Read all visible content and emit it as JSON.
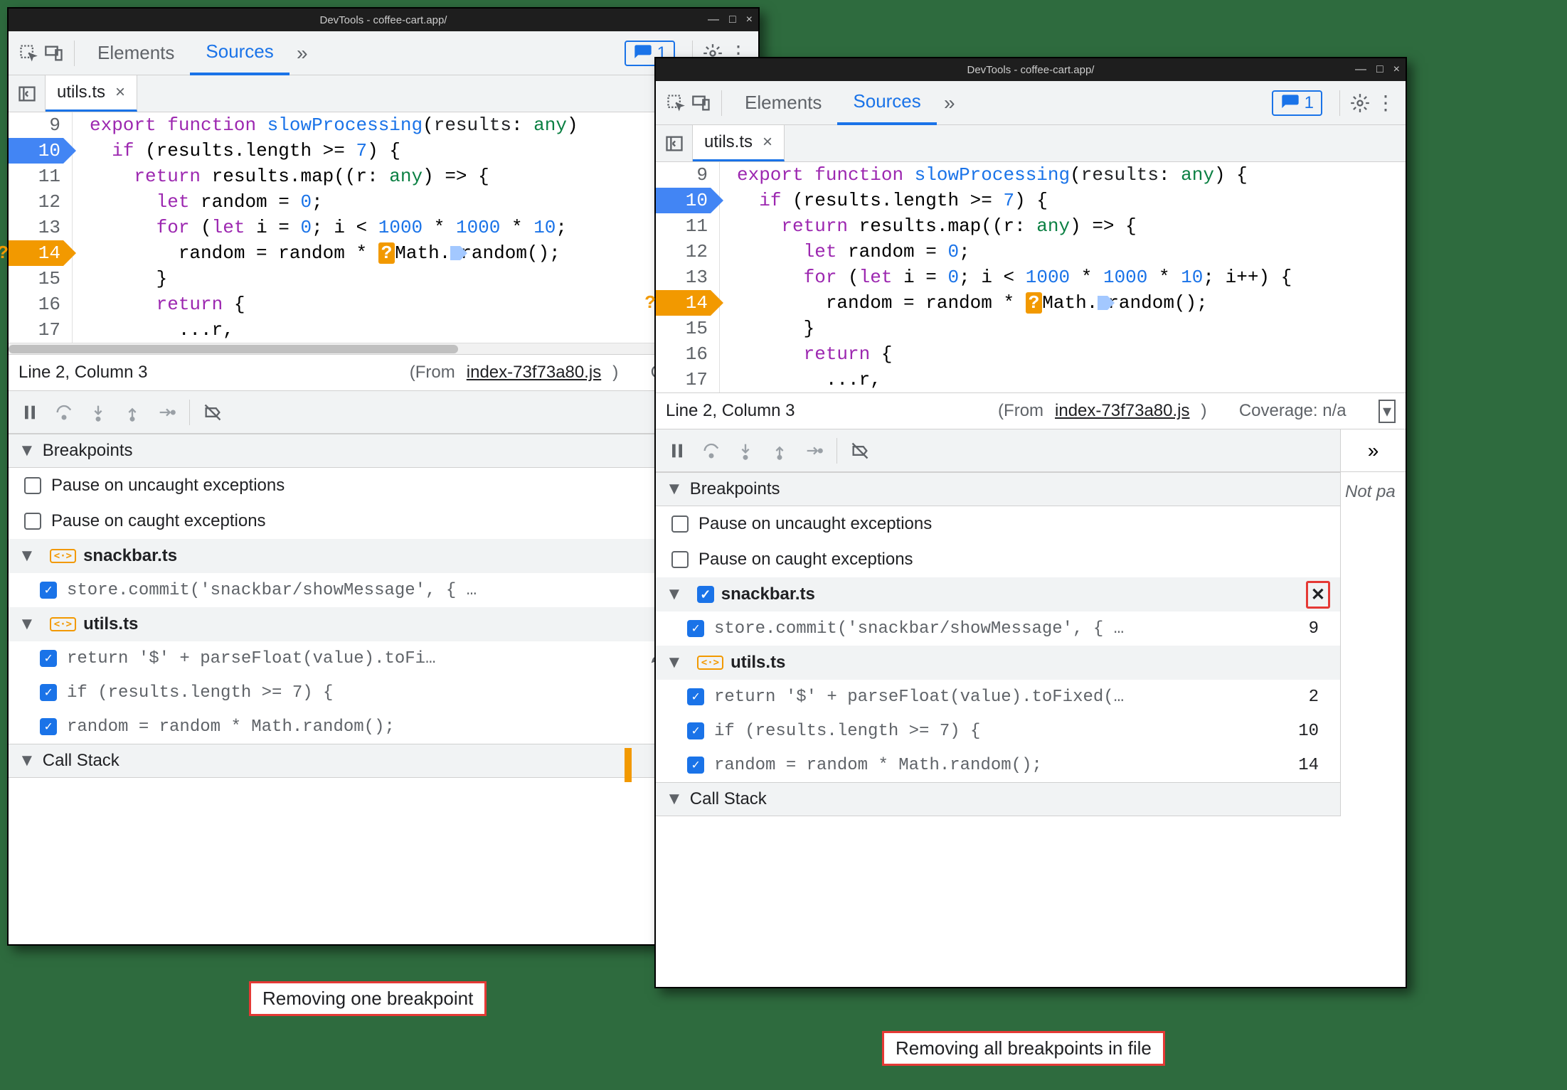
{
  "window_title": "DevTools - coffee-cart.app/",
  "toolbar": {
    "tab_elements": "Elements",
    "tab_sources": "Sources",
    "issues_count": "1"
  },
  "editor": {
    "filename": "utils.ts",
    "lines_1": [
      "9",
      "10",
      "11",
      "12",
      "13",
      "14",
      "15",
      "16",
      "17"
    ],
    "lines_2": [
      "9",
      "10",
      "11",
      "12",
      "13",
      "14",
      "15",
      "16",
      "17"
    ],
    "row9_a": "export",
    "row9_b": "function",
    "row9_c": "slowProcessing",
    "row9_d": "results",
    "row9_e": "any",
    "row10": "if (results.length >= 7) {",
    "row11": "return results.map((r: any) => {",
    "row12_a": "let",
    "row12_b": "random = ",
    "row12_c": "0",
    "row13_a": "for",
    "row13_b": "(",
    "row13_c": "let",
    "row13_d": "i = ",
    "row13_e": "0",
    "row13_f": "; i < ",
    "row13_g": "1000",
    "row13_h": " * ",
    "row13_i": "1000",
    "row13_j": " * ",
    "row13_k": "10",
    "row13_l": "; i++) {",
    "row14_a": "random = random * ",
    "row14_b": "?",
    "row14_c": "Math.",
    "row14_d": "random();",
    "row15": "}",
    "row16": "return",
    "row16_b": "{",
    "row17": "...r,"
  },
  "status": {
    "pos": "Line 2, Column 3",
    "from": "(From ",
    "from_file": "index-73f73a80.js",
    "from_close": ")",
    "coverage_1": "Coverage: n/",
    "coverage_2": "Coverage: n/a"
  },
  "breakpoints": {
    "header": "Breakpoints",
    "uncaught": "Pause on uncaught exceptions",
    "caught": "Pause on caught exceptions",
    "file1": "snackbar.ts",
    "file1_bp1": "store.commit('snackbar/showMessage', { …",
    "file1_bp1_line": "9",
    "file2": "utils.ts",
    "file2_bp1": "return '$' + parseFloat(value).toFi…",
    "file2_bp1_full": "return '$' + parseFloat(value).toFixed(…",
    "file2_bp1_line": "2",
    "file2_bp2": "if (results.length >= 7) {",
    "file2_bp2_line": "10",
    "file2_bp3": "random = random * Math.random();",
    "file2_bp3_line": "14"
  },
  "callstack": "Call Stack",
  "side": {
    "notpa": "Not pa"
  },
  "captions": {
    "one": "Removing one breakpoint",
    "all": "Removing all breakpoints in file"
  }
}
